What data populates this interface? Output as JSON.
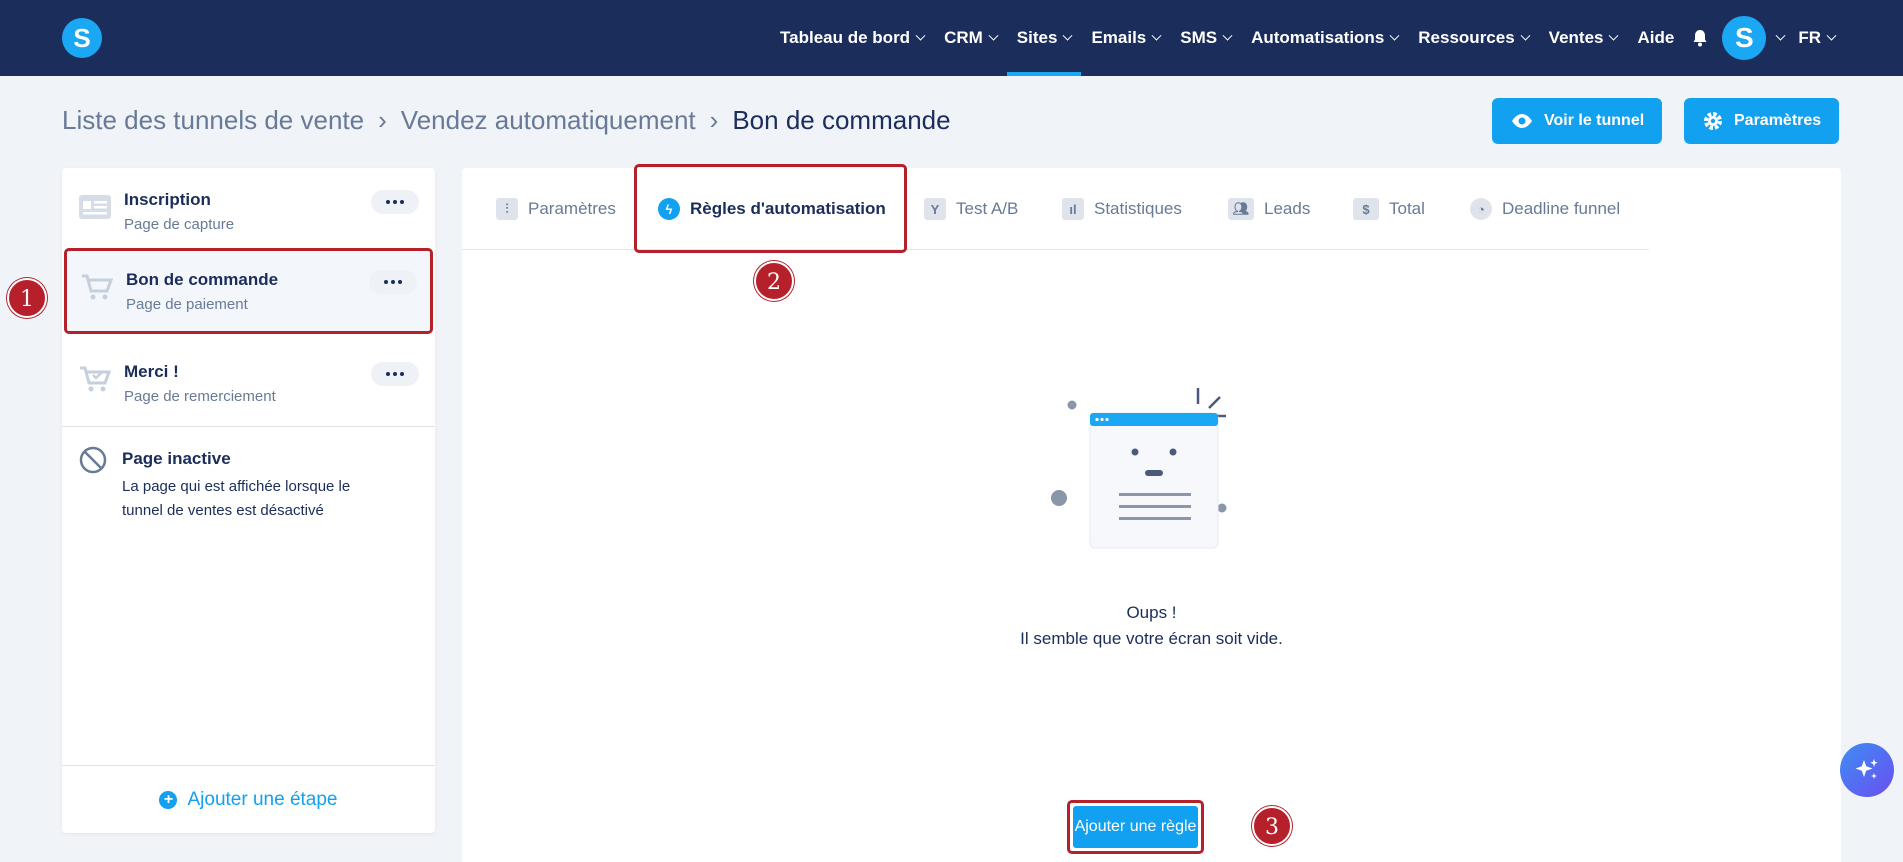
{
  "nav": {
    "items": [
      {
        "label": "Tableau de bord",
        "dropdown": true
      },
      {
        "label": "CRM",
        "dropdown": true
      },
      {
        "label": "Sites",
        "dropdown": true,
        "active": true
      },
      {
        "label": "Emails",
        "dropdown": true
      },
      {
        "label": "SMS",
        "dropdown": true
      },
      {
        "label": "Automatisations",
        "dropdown": true
      },
      {
        "label": "Ressources",
        "dropdown": true
      },
      {
        "label": "Ventes",
        "dropdown": true
      },
      {
        "label": "Aide",
        "dropdown": false
      }
    ],
    "avatar_letter": "S",
    "language": "FR",
    "logo_letter": "S"
  },
  "breadcrumb": {
    "items": [
      "Liste des tunnels de vente",
      "Vendez automatiquement",
      "Bon de commande"
    ]
  },
  "header_buttons": {
    "view_tunnel": "Voir le tunnel",
    "settings": "Paramètres"
  },
  "steps": [
    {
      "title": "Inscription",
      "subtitle": "Page de capture",
      "icon": "form-icon"
    },
    {
      "title": "Bon de commande",
      "subtitle": "Page de paiement",
      "icon": "cart-icon",
      "selected": true
    },
    {
      "title": "Merci !",
      "subtitle": "Page de remerciement",
      "icon": "cart-check-icon"
    }
  ],
  "inactive": {
    "title": "Page inactive",
    "description": "La page qui est affichée lorsque le tunnel de ventes est désactivé"
  },
  "add_step_label": "Ajouter une étape",
  "tabs": [
    {
      "label": "Paramètres",
      "icon": "sliders-icon"
    },
    {
      "label": "Règles d'automatisation",
      "icon": "bolt-icon",
      "active": true
    },
    {
      "label": "Test A/B",
      "icon": "split-icon"
    },
    {
      "label": "Statistiques",
      "icon": "bar-chart-icon"
    },
    {
      "label": "Leads",
      "icon": "users-icon"
    },
    {
      "label": "Total",
      "icon": "dollar-icon"
    },
    {
      "label": "Deadline funnel",
      "icon": "clock-icon"
    }
  ],
  "empty_state": {
    "line1": "Oups !",
    "line2": "Il semble que votre écran soit vide."
  },
  "add_rule_label": "Ajouter une règle",
  "callouts": [
    "1",
    "2",
    "3"
  ],
  "colors": {
    "navy": "#1b2d5b",
    "accent": "#12a1f0",
    "callout": "#b5202b"
  }
}
